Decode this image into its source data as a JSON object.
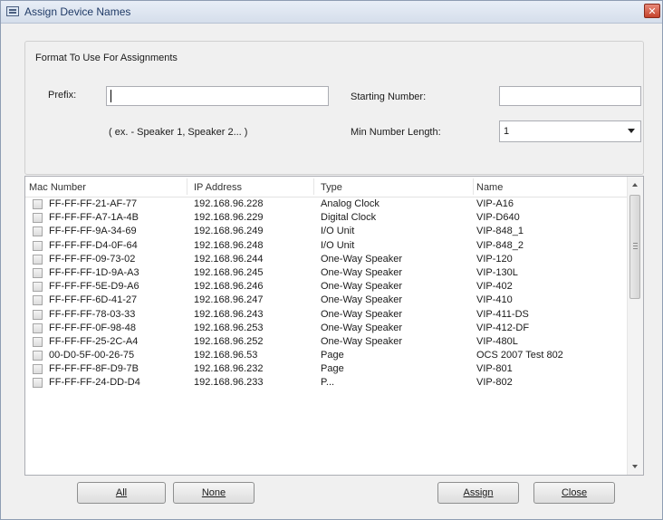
{
  "window": {
    "title": "Assign Device Names",
    "close_glyph": "✕"
  },
  "format": {
    "group_label": "Format To Use For Assignments",
    "prefix_label": "Prefix:",
    "prefix_value": "",
    "example_text": "( ex. - Speaker 1, Speaker 2... )",
    "starting_label": "Starting Number:",
    "starting_value": "",
    "minlen_label": "Min Number Length:",
    "minlen_value": "1"
  },
  "list": {
    "columns": [
      "Mac Number",
      "IP Address",
      "Type",
      "Name"
    ],
    "rows": [
      {
        "mac": "FF-FF-FF-21-AF-77",
        "ip": "192.168.96.228",
        "type": "Analog Clock",
        "name": "VIP-A16"
      },
      {
        "mac": "FF-FF-FF-A7-1A-4B",
        "ip": "192.168.96.229",
        "type": "Digital Clock",
        "name": "VIP-D640"
      },
      {
        "mac": "FF-FF-FF-9A-34-69",
        "ip": "192.168.96.249",
        "type": "I/O Unit",
        "name": "VIP-848_1"
      },
      {
        "mac": "FF-FF-FF-D4-0F-64",
        "ip": "192.168.96.248",
        "type": "I/O Unit",
        "name": "VIP-848_2"
      },
      {
        "mac": "FF-FF-FF-09-73-02",
        "ip": "192.168.96.244",
        "type": "One-Way Speaker",
        "name": "VIP-120"
      },
      {
        "mac": "FF-FF-FF-1D-9A-A3",
        "ip": "192.168.96.245",
        "type": "One-Way Speaker",
        "name": "VIP-130L"
      },
      {
        "mac": "FF-FF-FF-5E-D9-A6",
        "ip": "192.168.96.246",
        "type": "One-Way Speaker",
        "name": "VIP-402"
      },
      {
        "mac": "FF-FF-FF-6D-41-27",
        "ip": "192.168.96.247",
        "type": "One-Way Speaker",
        "name": "VIP-410"
      },
      {
        "mac": "FF-FF-FF-78-03-33",
        "ip": "192.168.96.243",
        "type": "One-Way Speaker",
        "name": "VIP-411-DS"
      },
      {
        "mac": "FF-FF-FF-0F-98-48",
        "ip": "192.168.96.253",
        "type": "One-Way Speaker",
        "name": "VIP-412-DF"
      },
      {
        "mac": "FF-FF-FF-25-2C-A4",
        "ip": "192.168.96.252",
        "type": "One-Way Speaker",
        "name": "VIP-480L"
      },
      {
        "mac": "00-D0-5F-00-26-75",
        "ip": "192.168.96.53",
        "type": "Page",
        "name": "OCS 2007 Test 802"
      },
      {
        "mac": "FF-FF-FF-8F-D9-7B",
        "ip": "192.168.96.232",
        "type": "Page",
        "name": "VIP-801"
      },
      {
        "mac": "FF-FF-FF-24-DD-D4",
        "ip": "192.168.96.233",
        "type": "P...",
        "name": "VIP-802"
      }
    ]
  },
  "buttons": {
    "all": "All",
    "none": "None",
    "assign": "Assign",
    "close": "Close"
  },
  "icons": {
    "window": "window-icon",
    "close": "close-icon",
    "scroll_up": "chevron-up-icon",
    "scroll_down": "chevron-down-icon",
    "dropdown": "chevron-down-icon"
  }
}
